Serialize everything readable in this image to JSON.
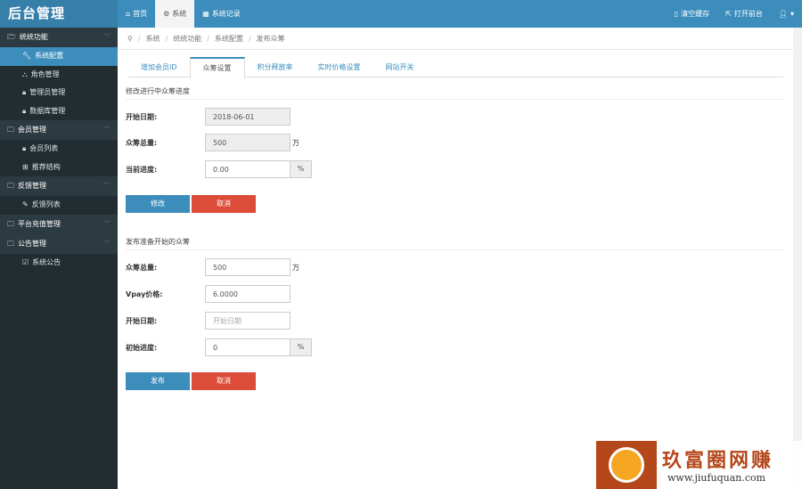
{
  "app": {
    "logo": "后台管理"
  },
  "top_nav": [
    {
      "icon": "home-icon",
      "label": "首页"
    },
    {
      "icon": "gear-icon",
      "label": "系统"
    },
    {
      "icon": "table-icon",
      "label": "系统记录"
    }
  ],
  "top_right": {
    "clear_cache": "清空缓存",
    "open_frontend": "打开前台"
  },
  "sidebar": {
    "groups": [
      {
        "label": "统统功能",
        "items": [
          "系统配置",
          "角色管理",
          "管理员管理",
          "数据库管理"
        ]
      },
      {
        "label": "会员管理",
        "items": [
          "会员列表",
          "推荐结构"
        ]
      },
      {
        "label": "反馈管理",
        "items": [
          "反馈列表"
        ]
      },
      {
        "label": "平台充值管理",
        "items": []
      },
      {
        "label": "公告管理",
        "items": [
          "系统公告"
        ]
      }
    ],
    "active_item": "系统配置"
  },
  "breadcrumb": [
    "系统",
    "统统功能",
    "系统配置",
    "发布众筹"
  ],
  "tabs": [
    "增加会员ID",
    "众筹设置",
    "积分释放率",
    "实时价格设置",
    "网站开关"
  ],
  "active_tab": "众筹设置",
  "section1": {
    "title": "修改进行中众筹进度",
    "start_date_label": "开始日期:",
    "start_date_value": "2018-06-01",
    "total_label": "众筹总量:",
    "total_value": "500",
    "total_unit": "万",
    "progress_label": "当前进度:",
    "progress_value": "0.00",
    "progress_unit": "%",
    "submit": "修改",
    "cancel": "取消"
  },
  "section2": {
    "title": "发布准备开始的众筹",
    "total_label": "众筹总量:",
    "total_value": "500",
    "total_unit": "万",
    "price_label": "Vpay价格:",
    "price_value": "6.0000",
    "start_date_label": "开始日期:",
    "start_date_placeholder": "开始日期",
    "progress_label": "初始进度:",
    "progress_value": "0",
    "progress_unit": "%",
    "submit": "发布",
    "cancel": "取消"
  },
  "watermark": {
    "text": "玖富圈网赚",
    "url": "www.jiufuquan.com"
  }
}
